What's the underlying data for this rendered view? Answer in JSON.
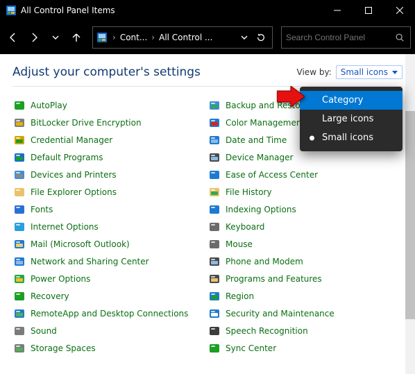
{
  "title": "All Control Panel Items",
  "breadcrumbs": {
    "a": "Cont...",
    "b": "All Control ..."
  },
  "search": {
    "placeholder": "Search Control Panel"
  },
  "heading": "Adjust your computer's settings",
  "viewby": {
    "label": "View by:",
    "value": "Small icons"
  },
  "menu": {
    "category": "Category",
    "large": "Large icons",
    "small": "Small icons"
  },
  "items_left": [
    {
      "name": "autoplay",
      "label": "AutoPlay",
      "color1": "#1aa022",
      "color2": "#1aa022"
    },
    {
      "name": "bitlocker",
      "label": "BitLocker Drive Encryption",
      "color1": "#7d7d7d",
      "color2": "#e0b400"
    },
    {
      "name": "credential-manager",
      "label": "Credential Manager",
      "color1": "#d7a100",
      "color2": "#1aa022"
    },
    {
      "name": "default-programs",
      "label": "Default Programs",
      "color1": "#166bd4",
      "color2": "#1aa022"
    },
    {
      "name": "devices-printers",
      "label": "Devices and Printers",
      "color1": "#3f8dde",
      "color2": "#8a8a8a"
    },
    {
      "name": "file-explorer-options",
      "label": "File Explorer Options",
      "color1": "#e9c36b",
      "color2": "#e9c36b"
    },
    {
      "name": "fonts",
      "label": "Fonts",
      "color1": "#2a6fd6",
      "color2": "#2a6fd6"
    },
    {
      "name": "internet-options",
      "label": "Internet Options",
      "color1": "#2a9fdc",
      "color2": "#2a9fdc"
    },
    {
      "name": "mail",
      "label": "Mail (Microsoft Outlook)",
      "color1": "#1f7ad1",
      "color2": "#f0d060"
    },
    {
      "name": "network-sharing",
      "label": "Network and Sharing Center",
      "color1": "#1f7ad1",
      "color2": "#93b8e6"
    },
    {
      "name": "power-options",
      "label": "Power Options",
      "color1": "#2aa540",
      "color2": "#e6c431"
    },
    {
      "name": "recovery",
      "label": "Recovery",
      "color1": "#1aa022",
      "color2": "#1aa022"
    },
    {
      "name": "remoteapp",
      "label": "RemoteApp and Desktop Connections",
      "color1": "#1f7ad1",
      "color2": "#4fb24f"
    },
    {
      "name": "sound",
      "label": "Sound",
      "color1": "#7b7b7b",
      "color2": "#7b7b7b"
    },
    {
      "name": "storage-spaces",
      "label": "Storage Spaces",
      "color1": "#7b7b7b",
      "color2": "#4fb24f"
    }
  ],
  "items_right": [
    {
      "name": "backup-restore",
      "label": "Backup and Restore (Windows",
      "color1": "#3f8dde",
      "color2": "#32a852"
    },
    {
      "name": "color-management",
      "label": "Color Management",
      "color1": "#1f7ad1",
      "color2": "#e01e1e"
    },
    {
      "name": "date-time",
      "label": "Date and Time",
      "color1": "#1f7ad1",
      "color2": "#8bbbe6"
    },
    {
      "name": "device-manager",
      "label": "Device Manager",
      "color1": "#4a4a4a",
      "color2": "#8bbbe6"
    },
    {
      "name": "ease-of-access",
      "label": "Ease of Access Center",
      "color1": "#1f7ad1",
      "color2": "#1f7ad1"
    },
    {
      "name": "file-history",
      "label": "File History",
      "color1": "#e9c36b",
      "color2": "#32a852"
    },
    {
      "name": "indexing-options",
      "label": "Indexing Options",
      "color1": "#1f7ad1",
      "color2": "#1f7ad1"
    },
    {
      "name": "keyboard",
      "label": "Keyboard",
      "color1": "#6b6b6b",
      "color2": "#6b6b6b"
    },
    {
      "name": "mouse",
      "label": "Mouse",
      "color1": "#6b6b6b",
      "color2": "#6b6b6b"
    },
    {
      "name": "phone-modem",
      "label": "Phone and Modem",
      "color1": "#4a4a4a",
      "color2": "#8bbbe6"
    },
    {
      "name": "programs-features",
      "label": "Programs and Features",
      "color1": "#4a4a4a",
      "color2": "#e9c36b"
    },
    {
      "name": "region",
      "label": "Region",
      "color1": "#1f7ad1",
      "color2": "#1aa022"
    },
    {
      "name": "security-maintenance",
      "label": "Security and Maintenance",
      "color1": "#1f7ad1",
      "color2": "#ffffff"
    },
    {
      "name": "speech-recognition",
      "label": "Speech Recognition",
      "color1": "#3d3d3d",
      "color2": "#3d3d3d"
    },
    {
      "name": "sync-center",
      "label": "Sync Center",
      "color1": "#1aa022",
      "color2": "#1aa022"
    }
  ]
}
